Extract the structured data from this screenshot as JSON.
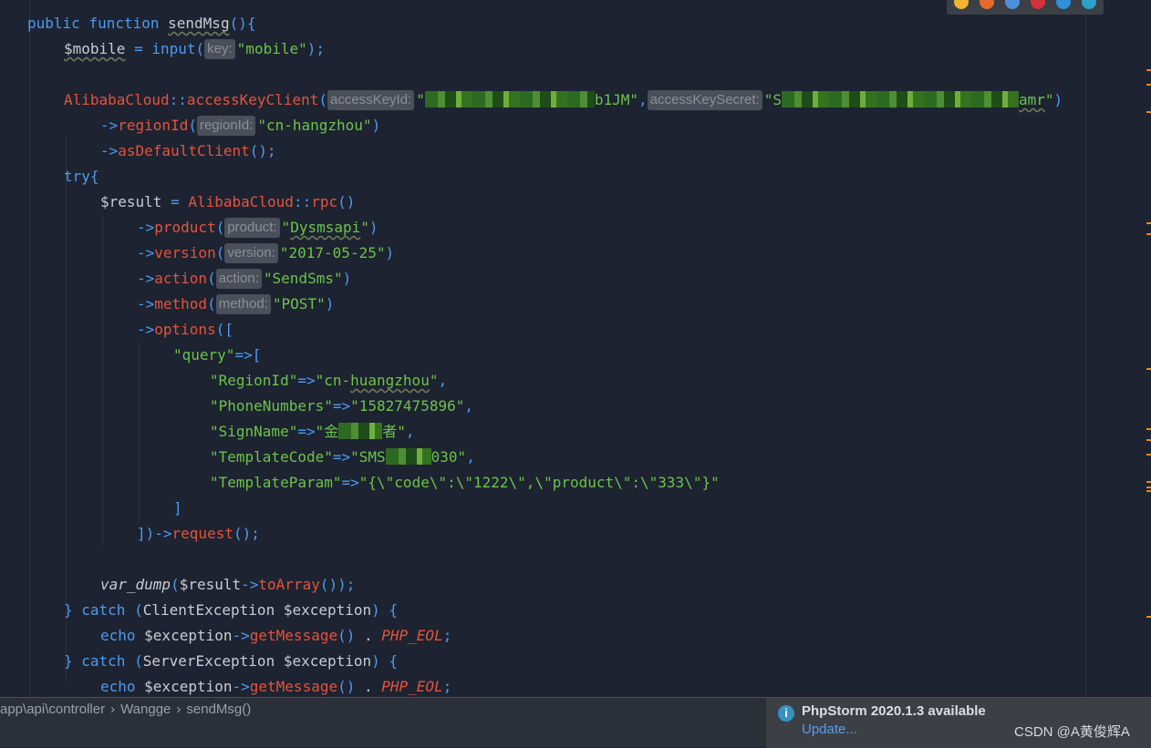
{
  "code": {
    "l1": {
      "kw1": "public",
      "kw2": "function",
      "fname": "sendMsg",
      "rest": "(){"
    },
    "l2": {
      "var": "$mobile",
      "eq": " = ",
      "fn": "input",
      "open": "(",
      "hint": "key:",
      "str": "\"mobile\"",
      "close": ");"
    },
    "l4": {
      "cls": "AlibabaCloud",
      "sep": "::",
      "fn": "accessKeyClient",
      "open": "(",
      "hint1": "accessKeyId:",
      "str1a": "\"",
      "str1b": "b1JM\"",
      "comma": ",",
      "hint2": "accessKeySecret:",
      "str2a": "\"S",
      "str2b": "amr",
      "str2c": "\"",
      "close": ")"
    },
    "l5": {
      "arrow": "->",
      "fn": "regionId",
      "open": "(",
      "hint": "regionId:",
      "str": "\"cn-hangzhou\"",
      "close": ")"
    },
    "l6": {
      "arrow": "->",
      "fn": "asDefaultClient",
      "rest": "();"
    },
    "l7": {
      "kw": "try",
      "rest": "{"
    },
    "l8": {
      "var": "$result",
      "eq": " = ",
      "cls": "AlibabaCloud",
      "sep": "::",
      "fn": "rpc",
      "rest": "()"
    },
    "l9": {
      "arrow": "->",
      "fn": "product",
      "open": "(",
      "hint": "product:",
      "q1": "\"",
      "str": "Dysmsapi",
      "q2": "\"",
      "close": ")"
    },
    "l10": {
      "arrow": "->",
      "fn": "version",
      "open": "(",
      "hint": "version:",
      "str": "\"2017-05-25\"",
      "close": ")"
    },
    "l11": {
      "arrow": "->",
      "fn": "action",
      "open": "(",
      "hint": "action:",
      "str": "\"SendSms\"",
      "close": ")"
    },
    "l12": {
      "arrow": "->",
      "fn": "method",
      "open": "(",
      "hint": "method:",
      "str": "\"POST\"",
      "close": ")"
    },
    "l13": {
      "arrow": "->",
      "fn": "options",
      "rest": "(["
    },
    "l14": {
      "str": "\"query\"",
      "op": "=>["
    },
    "l15": {
      "key": "\"RegionId\"",
      "op": "=>",
      "q1": "\"cn-",
      "sq": "huangzhou",
      "q2": "\"",
      "comma": ","
    },
    "l16": {
      "key": "\"PhoneNumbers\"",
      "op": "=>",
      "val": "\"15827475896\"",
      "comma": ","
    },
    "l17": {
      "key": "\"SignName\"",
      "op": "=>",
      "v1": "\"金",
      "v2": "者\"",
      "comma": ","
    },
    "l18": {
      "key": "\"TemplateCode\"",
      "op": "=>",
      "v1": "\"SMS",
      "v2": "030\"",
      "comma": ","
    },
    "l19": {
      "key": "\"TemplateParam\"",
      "op": "=>",
      "val": "\"{\\\"code\\\":\\\"1222\\\",\\\"product\\\":\\\"333\\\"}\""
    },
    "l20": {
      "rest": "]"
    },
    "l21": {
      "open": "])",
      "arrow": "->",
      "fn": "request",
      "rest": "();"
    },
    "l23": {
      "fn": "var_dump",
      "open": "(",
      "var": "$result",
      "arrow": "->",
      "fn2": "toArray",
      "rest": "());"
    },
    "l24": {
      "b": "} ",
      "kw": "catch",
      "open": " (",
      "cls": "ClientException",
      "var": " $exception",
      "close": ") {"
    },
    "l25": {
      "kw": "echo",
      "var": " $exception",
      "arrow": "->",
      "fn": "getMessage",
      "paren": "()",
      "dot": " . ",
      "const": "PHP_EOL",
      "semi": ";"
    },
    "l26": {
      "b": "} ",
      "kw": "catch",
      "open": " (",
      "cls": "ServerException",
      "var": " $exception",
      "close": ") {"
    },
    "l27": {
      "kw": "echo",
      "var": " $exception",
      "arrow": "->",
      "fn": "getMessage",
      "paren": "()",
      "dot": " . ",
      "const": "PHP_EOL",
      "semi": ";"
    }
  },
  "breadcrumb": {
    "path": "app\\api\\controller",
    "sep1": "›",
    "cls": "Wangge",
    "sep2": "›",
    "method": "sendMsg()"
  },
  "notification": {
    "icon": "i",
    "title": "PhpStorm 2020.1.3 available",
    "link": "Update..."
  },
  "watermark": "CSDN @A黄俊辉A",
  "colors": {
    "keyword": "#4e9af3",
    "function": "#e5533d",
    "string": "#6cc34a",
    "background": "#1d2330"
  }
}
